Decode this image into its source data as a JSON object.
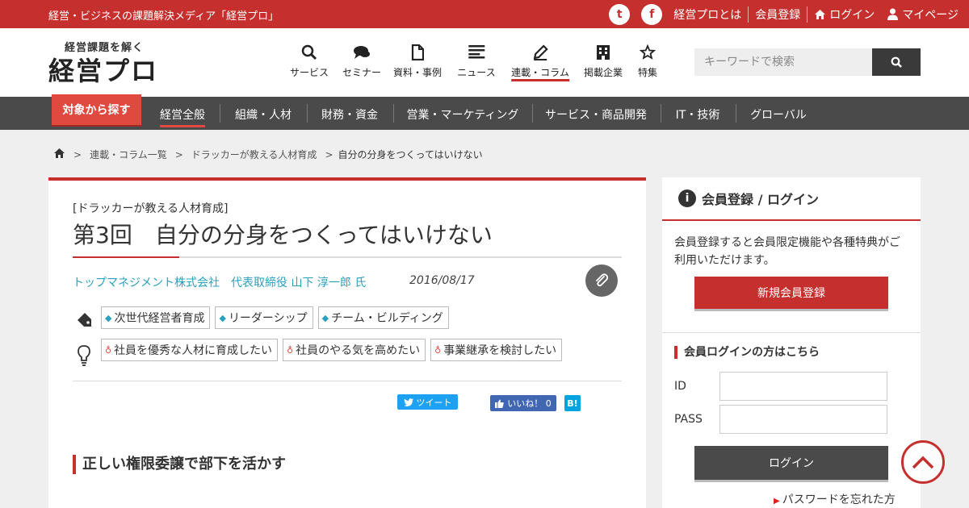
{
  "topbar": {
    "tagline": "経営・ビジネスの課題解決メディア「経営プロ」",
    "twitter_icon": "t",
    "facebook_icon": "f",
    "about": "経営プロとは",
    "register": "会員登録",
    "login": "ログイン",
    "mypage": "マイページ",
    "bg_color": "#c5302e"
  },
  "header": {
    "logo_sub": "経営課題を解く",
    "logo": "経営プロ",
    "nav": [
      {
        "label": "サービス",
        "icon": "search-icon"
      },
      {
        "label": "セミナー",
        "icon": "chat-icon"
      },
      {
        "label": "資料・事例",
        "icon": "document-icon"
      },
      {
        "label": "ニュース",
        "icon": "news-icon"
      },
      {
        "label": "連載・コラム",
        "icon": "pencil-icon"
      },
      {
        "label": "掲載企業",
        "icon": "building-icon"
      },
      {
        "label": "特集",
        "icon": "star-icon"
      }
    ],
    "search_placeholder": "キーワードで検索"
  },
  "catbar": {
    "target": "対象から探す",
    "items": [
      "経営全般",
      "組織・人材",
      "財務・資金",
      "営業・マーケティング",
      "サービス・商品開発",
      "IT・技術",
      "グローバル"
    ]
  },
  "breadcrumb": {
    "items": [
      "連載・コラム一覧",
      "ドラッカーが教える人材育成",
      "自分の分身をつくってはいけない"
    ]
  },
  "article": {
    "series": "[ドラッカーが教える人材育成]",
    "title": "第3回　自分の分身をつくってはいけない",
    "author": "トップマネジメント株式会社　代表取締役 山下 淳一郎 氏",
    "date": "2016/08/17",
    "tags": [
      "次世代経営者育成",
      "リーダーシップ",
      "チーム・ビルディング"
    ],
    "issues": [
      "社員を優秀な人材に育成したい",
      "社員のやる気を高めたい",
      "事業継承を検討したい"
    ],
    "tweet": "ツイート",
    "like": "いいね！ 0",
    "hatena": "B!",
    "section_heading": "正しい権限委譲で部下を活かす"
  },
  "sidebar": {
    "title": "会員登録 / ログイン",
    "description": "会員登録すると会員限定機能や各種特典がご利用いただけます。",
    "register_button": "新規会員登録",
    "login_heading": "会員ログインの方はこちら",
    "id_label": "ID",
    "pass_label": "PASS",
    "login_button": "ログイン",
    "forgot": "パスワードを忘れた方"
  }
}
